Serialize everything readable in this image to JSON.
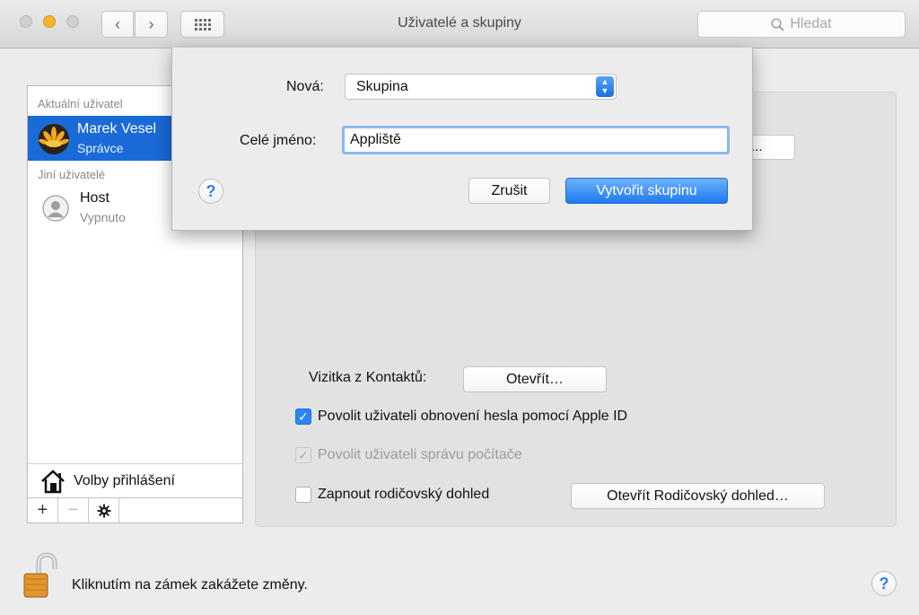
{
  "window": {
    "title": "Uživatelé a skupiny"
  },
  "toolbar": {
    "back_icon": "‹",
    "forward_icon": "›",
    "search_placeholder": "Hledat"
  },
  "sidebar": {
    "current_section": "Aktuální uživatel",
    "current_user": {
      "name": "Marek Vesel",
      "role": "Správce"
    },
    "other_section": "Jiní uživatelé",
    "other_users": [
      {
        "name": "Host",
        "role": "Vypnuto"
      }
    ],
    "login_options_label": "Volby přihlášení",
    "add_label": "+",
    "remove_label": "−",
    "settings_label": "✱"
  },
  "dialog": {
    "new_label": "Nová:",
    "new_value": "Skupina",
    "fullname_label": "Celé jméno:",
    "fullname_value": "Appliště",
    "help_label": "?",
    "cancel_label": "Zrušit",
    "create_label": "Vytvořit skupinu"
  },
  "panel": {
    "partial_button_label": "...",
    "contact_label": "Vizitka z Kontaktů:",
    "contact_open_label": "Otevřít…",
    "checkbox_reset_label": "Povolit uživateli obnovení hesla pomocí Apple ID",
    "checkbox_reset_checked": true,
    "checkbox_admin_label": "Povolit uživateli správu počítače",
    "checkbox_admin_checked": true,
    "checkbox_parental_label": "Zapnout rodičovský dohled",
    "checkbox_parental_checked": false,
    "parental_open_label": "Otevřít Rodičovský dohled…"
  },
  "footer": {
    "lock_text": "Kliknutím na zámek zakážete změny.",
    "help_label": "?"
  },
  "colors": {
    "accent": "#1a6ad7",
    "close": "#cfcfcf",
    "minimize": "#f5b42a"
  }
}
